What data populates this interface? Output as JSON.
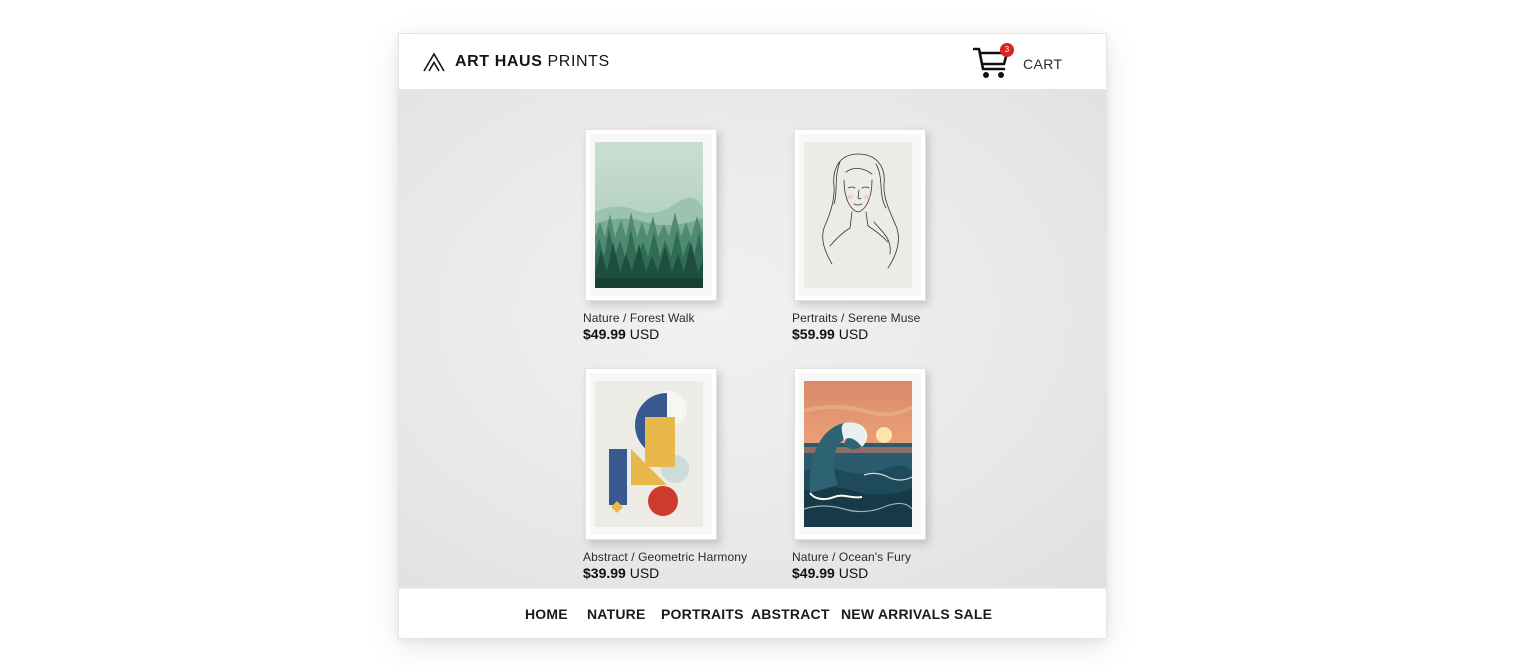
{
  "header": {
    "brand_bold": "ART HAUS",
    "brand_light": "PRINTS",
    "logo_icon": "mountain-logo-icon",
    "cart_label": "CART",
    "cart_count": "3",
    "cart_icon": "shopping-cart-icon"
  },
  "products": [
    {
      "caption": "Nature / Forest Walk",
      "price": "$49.99",
      "currency": "USD",
      "artwork": "misty-pine-forest"
    },
    {
      "caption": "Pertraits / Serene Muse",
      "price": "$59.99",
      "currency": "USD",
      "artwork": "line-drawing-woman-portrait"
    },
    {
      "caption": "Abstract / Geometric Harmony",
      "price": "$39.99",
      "currency": "USD",
      "artwork": "geometric-shapes-blue-yellow-red"
    },
    {
      "caption": "Nature / Ocean's Fury",
      "price": "$49.99",
      "currency": "USD",
      "artwork": "crashing-wave-sunset"
    }
  ],
  "nav": {
    "items": [
      "HOME",
      "NATURE",
      "PORTRAITS",
      "ABSTRACT",
      "NEW ARRIVALS",
      "SALE"
    ],
    "active": "HOME"
  },
  "colors": {
    "accent": "#1a1a1a",
    "badge": "#d8231f",
    "forest_green": "#2f6b55",
    "abstract_blue": "#37598f",
    "abstract_yellow": "#e8b84a",
    "abstract_red": "#cc3b2e",
    "wave_teal": "#2a5c6e",
    "sunset_orange": "#e98a5e"
  }
}
